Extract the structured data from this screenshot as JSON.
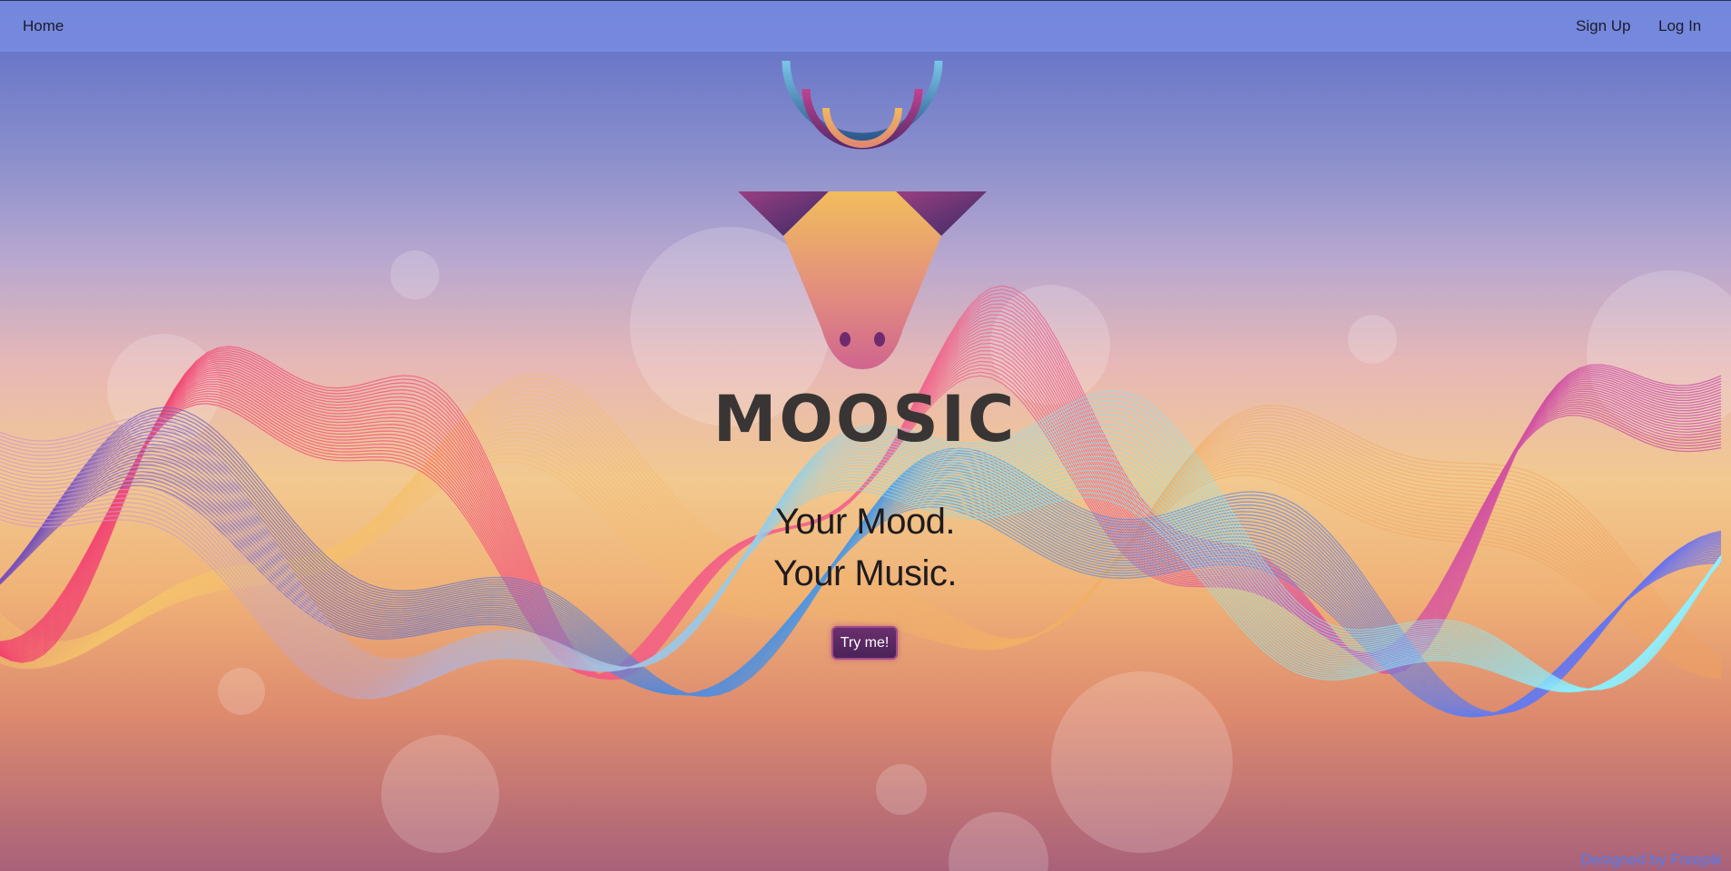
{
  "nav": {
    "home_label": "Home",
    "signup_label": "Sign Up",
    "login_label": "Log In"
  },
  "hero": {
    "title": "MOOSIC",
    "tagline_line1": "Your Mood.",
    "tagline_line2": "Your Music.",
    "cta_label": "Try me!"
  },
  "footer": {
    "credit": "Designed by Freepik"
  },
  "colors": {
    "nav_bg": "#788ce1",
    "title_text": "#3a3535",
    "cta_bg": "#5a2a64",
    "credit_link": "#4e7df2"
  },
  "icons": {
    "logo": "moose-head-logo"
  }
}
